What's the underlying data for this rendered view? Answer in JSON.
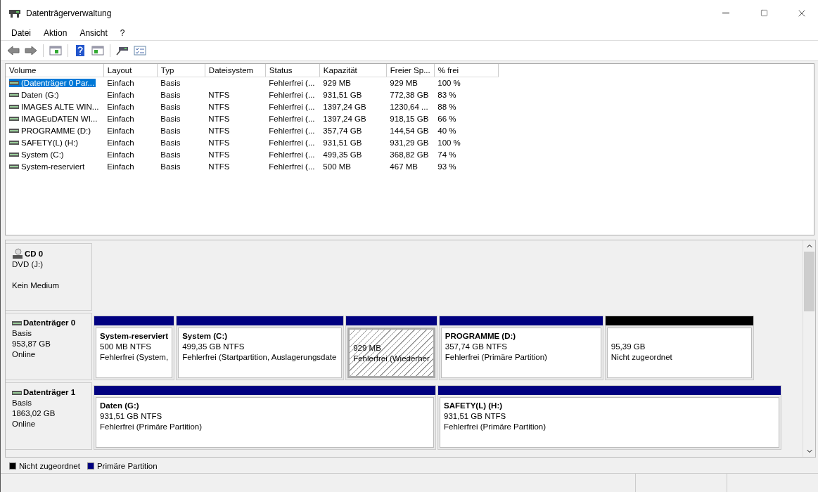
{
  "window": {
    "title": "Datenträgerverwaltung"
  },
  "menu": [
    "Datei",
    "Aktion",
    "Ansicht",
    "?"
  ],
  "table": {
    "columns": [
      "Volume",
      "Layout",
      "Typ",
      "Dateisystem",
      "Status",
      "Kapazität",
      "Freier Sp...",
      "% frei"
    ],
    "rows": [
      {
        "selected": true,
        "cells": [
          "(Datenträger 0 Par...",
          "Einfach",
          "Basis",
          "",
          "Fehlerfrei (...",
          "929 MB",
          "929 MB",
          "100 %"
        ]
      },
      {
        "selected": false,
        "cells": [
          "Daten (G:)",
          "Einfach",
          "Basis",
          "NTFS",
          "Fehlerfrei (...",
          "931,51 GB",
          "772,38 GB",
          "83 %"
        ]
      },
      {
        "selected": false,
        "cells": [
          "IMAGES ALTE WIN...",
          "Einfach",
          "Basis",
          "NTFS",
          "Fehlerfrei (...",
          "1397,24 GB",
          "1230,64 ...",
          "88 %"
        ]
      },
      {
        "selected": false,
        "cells": [
          "IMAGEuDATEN WI...",
          "Einfach",
          "Basis",
          "NTFS",
          "Fehlerfrei (...",
          "1397,24 GB",
          "918,15 GB",
          "66 %"
        ]
      },
      {
        "selected": false,
        "cells": [
          "PROGRAMME (D:)",
          "Einfach",
          "Basis",
          "NTFS",
          "Fehlerfrei (...",
          "357,74 GB",
          "144,54 GB",
          "40 %"
        ]
      },
      {
        "selected": false,
        "cells": [
          "SAFETY(L) (H:)",
          "Einfach",
          "Basis",
          "NTFS",
          "Fehlerfrei (...",
          "931,51 GB",
          "931,29 GB",
          "100 %"
        ]
      },
      {
        "selected": false,
        "cells": [
          "System (C:)",
          "Einfach",
          "Basis",
          "NTFS",
          "Fehlerfrei (...",
          "499,35 GB",
          "368,82 GB",
          "74 %"
        ]
      },
      {
        "selected": false,
        "cells": [
          "System-reserviert",
          "Einfach",
          "Basis",
          "NTFS",
          "Fehlerfrei (...",
          "500 MB",
          "467 MB",
          "93 %"
        ]
      }
    ]
  },
  "disks": [
    {
      "kind": "cd",
      "name": "CD 0",
      "lines": [
        "DVD (J:)",
        "Kein Medium"
      ]
    },
    {
      "kind": "disk",
      "name": "Datenträger 0",
      "lines": [
        "Basis",
        "953,87 GB",
        "Online"
      ],
      "partitions": [
        {
          "kind": "primary",
          "selected": false,
          "name": "System-reserviert",
          "size": "500 MB NTFS",
          "status": "Fehlerfrei (System,"
        },
        {
          "kind": "primary",
          "selected": false,
          "name": "System  (C:)",
          "size": "499,35 GB NTFS",
          "status": "Fehlerfrei (Startpartition, Auslagerungsdate"
        },
        {
          "kind": "primary",
          "selected": true,
          "size": "929 MB",
          "status": "Fehlerfrei (Wiederher"
        },
        {
          "kind": "primary",
          "selected": false,
          "name": "PROGRAMME  (D:)",
          "size": "357,74 GB NTFS",
          "status": "Fehlerfrei (Primäre Partition)"
        },
        {
          "kind": "unallocated",
          "selected": false,
          "size": "95,39 GB",
          "status": "Nicht zugeordnet"
        }
      ]
    },
    {
      "kind": "disk",
      "name": "Datenträger 1",
      "lines": [
        "Basis",
        "1863,02 GB",
        "Online"
      ],
      "partitions": [
        {
          "kind": "primary",
          "selected": false,
          "name": "Daten  (G:)",
          "size": "931,51 GB NTFS",
          "status": "Fehlerfrei (Primäre Partition)"
        },
        {
          "kind": "primary",
          "selected": false,
          "name": "SAFETY(L)  (H:)",
          "size": "931,51 GB NTFS",
          "status": "Fehlerfrei (Primäre Partition)"
        }
      ]
    }
  ],
  "legend": [
    {
      "label": "Nicht zugeordnet",
      "color": "#000000"
    },
    {
      "label": "Primäre Partition",
      "color": "#000080"
    }
  ]
}
